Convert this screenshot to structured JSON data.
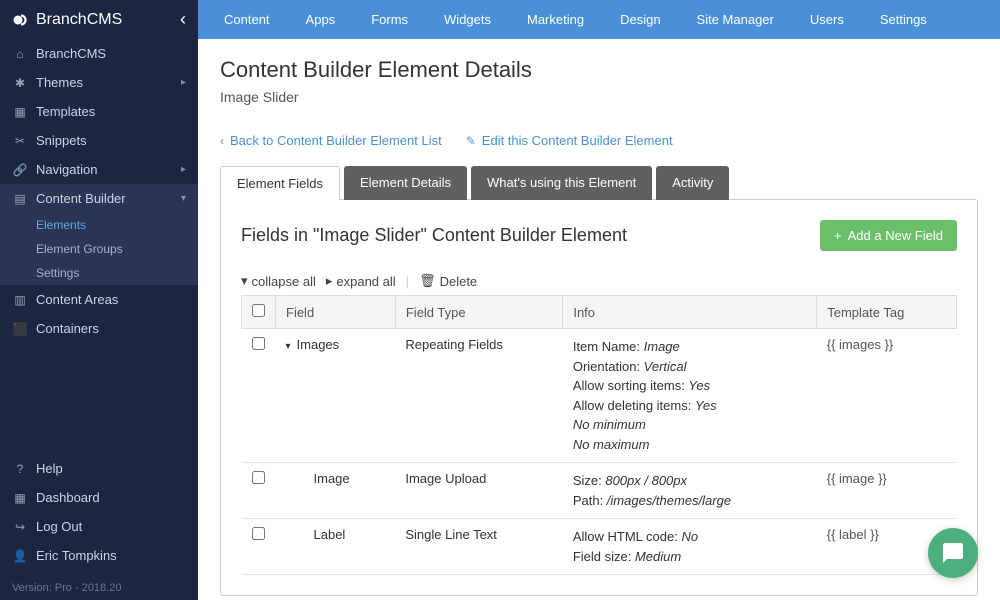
{
  "brand": "BranchCMS",
  "topnav": [
    "Content",
    "Apps",
    "Forms",
    "Widgets",
    "Marketing",
    "Design",
    "Site Manager",
    "Users",
    "Settings"
  ],
  "sidebar": {
    "items": [
      {
        "icon": "home",
        "label": "BranchCMS"
      },
      {
        "icon": "gear",
        "label": "Themes",
        "chev": true
      },
      {
        "icon": "template",
        "label": "Templates"
      },
      {
        "icon": "scissors",
        "label": "Snippets"
      },
      {
        "icon": "link",
        "label": "Navigation",
        "chev": true
      },
      {
        "icon": "grid",
        "label": "Content Builder",
        "expanded": true,
        "sub": [
          "Elements",
          "Element Groups",
          "Settings"
        ],
        "activeSub": 0
      },
      {
        "icon": "layout",
        "label": "Content Areas"
      },
      {
        "icon": "cube",
        "label": "Containers"
      }
    ],
    "footer": [
      {
        "icon": "help",
        "label": "Help"
      },
      {
        "icon": "dashboard",
        "label": "Dashboard"
      },
      {
        "icon": "logout",
        "label": "Log Out"
      },
      {
        "icon": "user",
        "label": "Eric Tompkins"
      }
    ],
    "version": "Version: Pro - 2018.20"
  },
  "page": {
    "title": "Content Builder Element Details",
    "subtitle": "Image Slider",
    "back_link": "Back to Content Builder Element List",
    "edit_link": "Edit this Content Builder Element"
  },
  "tabs": [
    "Element Fields",
    "Element Details",
    "What's using this Element",
    "Activity"
  ],
  "active_tab": 0,
  "panel": {
    "title": "Fields in \"Image Slider\" Content Builder Element",
    "add_button": "Add a New Field",
    "collapse_all": "collapse all",
    "expand_all": "expand all",
    "delete": "Delete",
    "columns": [
      "Field",
      "Field Type",
      "Info",
      "Template Tag"
    ],
    "rows": [
      {
        "field": "Images",
        "type": "Repeating Fields",
        "toggle": true,
        "info": [
          {
            "label": "Item Name",
            "value": "Image"
          },
          {
            "label": "Orientation",
            "value": "Vertical"
          },
          {
            "label": "Allow sorting items",
            "value": "Yes"
          },
          {
            "label": "Allow deleting items",
            "value": "Yes"
          },
          {
            "plain": "No minimum"
          },
          {
            "plain": "No maximum"
          }
        ],
        "tag": "{{ images }}"
      },
      {
        "field": "Image",
        "type": "Image Upload",
        "indent": true,
        "info": [
          {
            "label": "Size",
            "value": "800px / 800px"
          },
          {
            "label": "Path",
            "value": "/images/themes/large"
          }
        ],
        "tag": "{{ image }}"
      },
      {
        "field": "Label",
        "type": "Single Line Text",
        "indent": true,
        "info": [
          {
            "label": "Allow HTML code",
            "value": "No"
          },
          {
            "label": "Field size",
            "value": "Medium"
          }
        ],
        "tag": "{{ label }}"
      }
    ]
  },
  "icons": {
    "home": "⌂",
    "gear": "✱",
    "template": "▦",
    "scissors": "✂",
    "link": "🔗",
    "grid": "▤",
    "layout": "▥",
    "cube": "⬛",
    "help": "?",
    "dashboard": "▦",
    "logout": "↪",
    "user": "👤"
  }
}
